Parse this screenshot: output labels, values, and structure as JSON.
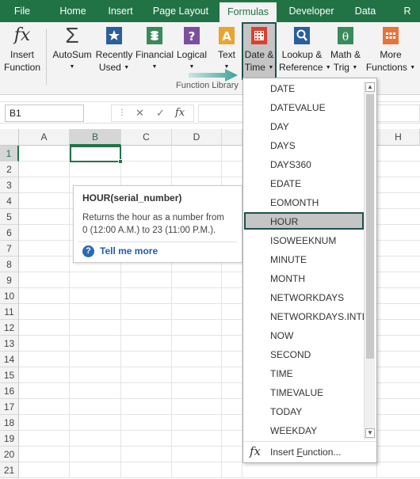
{
  "tabs": [
    "File",
    "Home",
    "Insert",
    "Page Layout",
    "Formulas",
    "Developer",
    "Data",
    "R"
  ],
  "active_tab": "Formulas",
  "ribbon": {
    "insert_function": [
      "Insert",
      "Function"
    ],
    "autosum": "AutoSum",
    "recently_used": [
      "Recently",
      "Used"
    ],
    "financial": "Financial",
    "logical": "Logical",
    "text": "Text",
    "date_time": [
      "Date &",
      "Time"
    ],
    "lookup_reference": [
      "Lookup &",
      "Reference"
    ],
    "math_trig": [
      "Math &",
      "Trig"
    ],
    "more_functions": [
      "More",
      "Functions"
    ],
    "group_label": "Function Library"
  },
  "formula_bar": {
    "name_box": "B1",
    "cancel": "✕",
    "enter": "✓",
    "fx": "fx"
  },
  "columns": [
    "A",
    "B",
    "C",
    "D",
    "H"
  ],
  "selected_column": "B",
  "rows": [
    "1",
    "2",
    "3",
    "4",
    "5",
    "6",
    "7",
    "8",
    "9",
    "10",
    "11",
    "12",
    "13",
    "14",
    "15",
    "16",
    "17",
    "18",
    "19",
    "20",
    "21"
  ],
  "selected_row": "1",
  "tooltip": {
    "title": "HOUR(serial_number)",
    "line1": "Returns the hour as a number from",
    "line2": "0 (12:00 A.M.) to 23 (11:00 P.M.).",
    "help_icon": "?",
    "link": "Tell me more"
  },
  "dropdown": {
    "items": [
      "DATE",
      "DATEVALUE",
      "DAY",
      "DAYS",
      "DAYS360",
      "EDATE",
      "EOMONTH",
      "HOUR",
      "ISOWEEKNUM",
      "MINUTE",
      "MONTH",
      "NETWORKDAYS",
      "NETWORKDAYS.INTL",
      "NOW",
      "SECOND",
      "TIME",
      "TIMEVALUE",
      "TODAY",
      "WEEKDAY"
    ],
    "highlighted": "HOUR",
    "insert_function_icon": "fx",
    "insert_function_pre": "Insert ",
    "insert_function_u": "F",
    "insert_function_post": "unction..."
  },
  "colors": {
    "excel_green": "#217346",
    "highlight_border": "#1f5050",
    "arrow": "#3aa39a",
    "link_blue": "#1f5ea8"
  }
}
